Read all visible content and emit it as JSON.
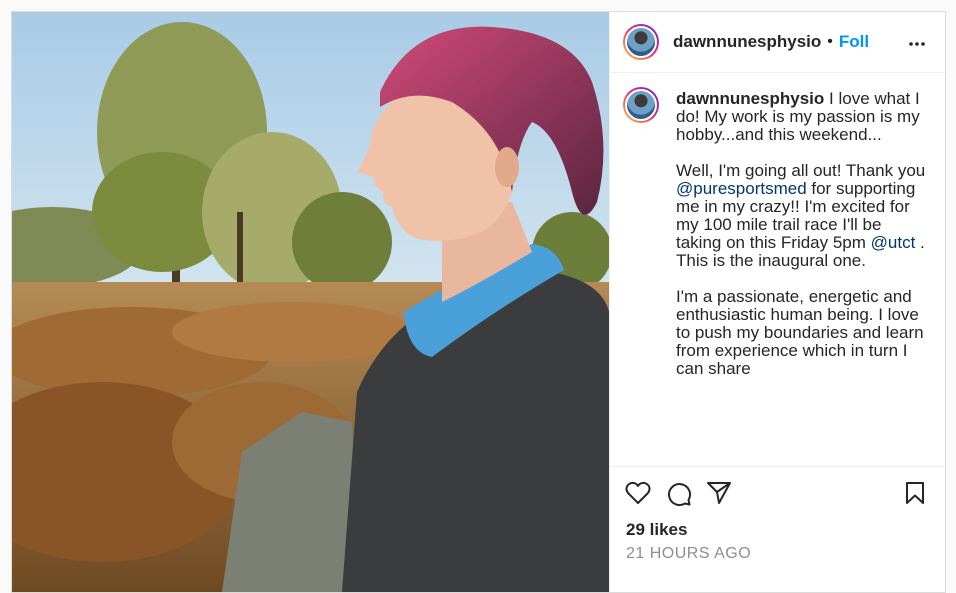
{
  "post": {
    "username": "dawnnunesphysio",
    "separator": "•",
    "follow_label": "Foll",
    "caption_segments": [
      {
        "type": "text",
        "text": " I love what I do! My work is my passion is my hobby...and this weekend...\n\nWell, I'm going all out! Thank you "
      },
      {
        "type": "mention",
        "text": "@puresportsmed"
      },
      {
        "type": "text",
        "text": " for supporting me in my crazy!! I'm excited for my 100 mile trail race I'll be taking on this Friday 5pm "
      },
      {
        "type": "mention",
        "text": "@utct"
      },
      {
        "type": "text",
        "text": " . This is the inaugural one.\n\nI'm a passionate, energetic and enthusiastic human being. I love to push my boundaries and learn from experience which in turn I can share"
      }
    ],
    "likes": "29 likes",
    "timestamp": "21 HOURS AGO"
  },
  "icons": {
    "more": "more-options-icon",
    "like": "heart-icon",
    "comment": "comment-icon",
    "share": "share-icon",
    "save": "bookmark-icon"
  },
  "colors": {
    "follow": "#0095f6",
    "mention": "#00376b",
    "muted": "#8e8e8e",
    "border": "#dbdbdb"
  }
}
